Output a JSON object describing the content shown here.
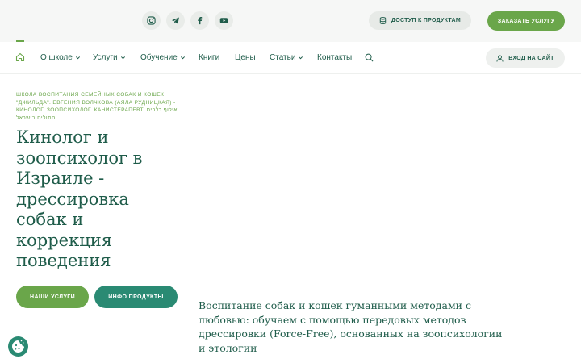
{
  "topbar": {
    "social": [
      {
        "name": "instagram-icon"
      },
      {
        "name": "telegram-icon"
      },
      {
        "name": "facebook-icon"
      },
      {
        "name": "youtube-icon"
      }
    ],
    "access_label": "Доступ к продуктам",
    "order_label": "Заказать услугу"
  },
  "nav": {
    "items": [
      {
        "label": "О школе",
        "dropdown": true
      },
      {
        "label": "Услуги",
        "dropdown": true
      },
      {
        "label": "Обучение",
        "dropdown": true
      },
      {
        "label": "Книги",
        "dropdown": false
      },
      {
        "label": "Цены",
        "dropdown": false
      },
      {
        "label": "Статьи",
        "dropdown": true
      },
      {
        "label": "Контакты",
        "dropdown": false
      }
    ],
    "login_label": "Вход на сайт"
  },
  "hero": {
    "subtitle": "Школа воспитания семейных собак и кошек \"Джильда\". Евгения Волчкова (Аяла Рудницкая) - кинолог. зоопсихолог. канистерапевт. אילוף כלבים וחתולים בישראל",
    "title": "Кинолог и зоопсихолог в Израиле - дрессировка собак и коррекция поведения",
    "services_label": "Наши услуги",
    "info_label": "Инфо продукты",
    "description": "Воспитание собак и кошек гуманными методами с любовью: обучаем с помощью передовых методов дрессировки (Force-Free), основанных на зоопсихологии и этологии"
  },
  "colors": {
    "primary_green": "#6aa64a",
    "teal": "#2a8a73",
    "dark_text": "#1f5c4a"
  }
}
